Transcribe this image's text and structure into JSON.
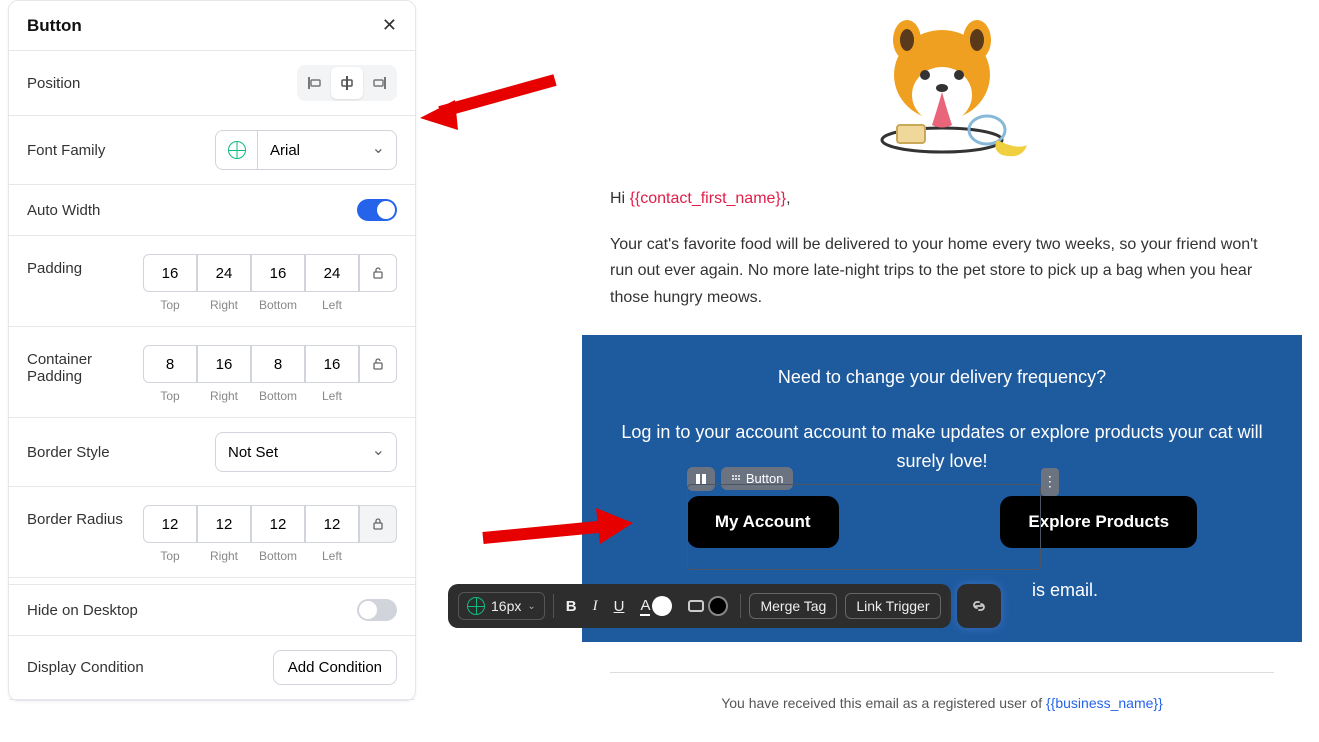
{
  "panel": {
    "title": "Button",
    "position_label": "Position",
    "font_family_label": "Font Family",
    "font_family_value": "Arial",
    "auto_width_label": "Auto Width",
    "auto_width_on": true,
    "padding_label": "Padding",
    "padding": {
      "top": "16",
      "right": "24",
      "bottom": "16",
      "left": "24"
    },
    "container_padding_label": "Container Padding",
    "container_padding": {
      "top": "8",
      "right": "16",
      "bottom": "8",
      "left": "16"
    },
    "sides": {
      "top": "Top",
      "right": "Right",
      "bottom": "Bottom",
      "left": "Left"
    },
    "border_style_label": "Border Style",
    "border_style_value": "Not Set",
    "border_radius_label": "Border Radius",
    "border_radius": {
      "top": "12",
      "right": "12",
      "bottom": "12",
      "left": "12"
    },
    "hide_desktop_label": "Hide on Desktop",
    "hide_desktop_on": false,
    "display_condition_label": "Display Condition",
    "add_condition_label": "Add Condition"
  },
  "toolbar": {
    "font_size": "16px",
    "merge_tag": "Merge Tag",
    "link_trigger": "Link Trigger"
  },
  "preview": {
    "greeting_prefix": "Hi ",
    "greeting_merge": "{{contact_first_name}}",
    "greeting_suffix": ",",
    "body": "Your cat's favorite food will be delivered to your home every two weeks, so your friend won't run out ever again. No more late-night trips to the pet store to pick up a bag when you hear those hungry meows.",
    "cta_line1": "Need to change your delivery frequency?",
    "cta_line2": "Log in to your account account to make updates or explore products your cat will surely love!",
    "btn_my_account": "My Account",
    "btn_explore": "Explore Products",
    "this_email": "is email.",
    "footer_prefix": "You have received this email as a registered user of ",
    "footer_merge": "{{business_name}}",
    "pill_label": "Button"
  }
}
